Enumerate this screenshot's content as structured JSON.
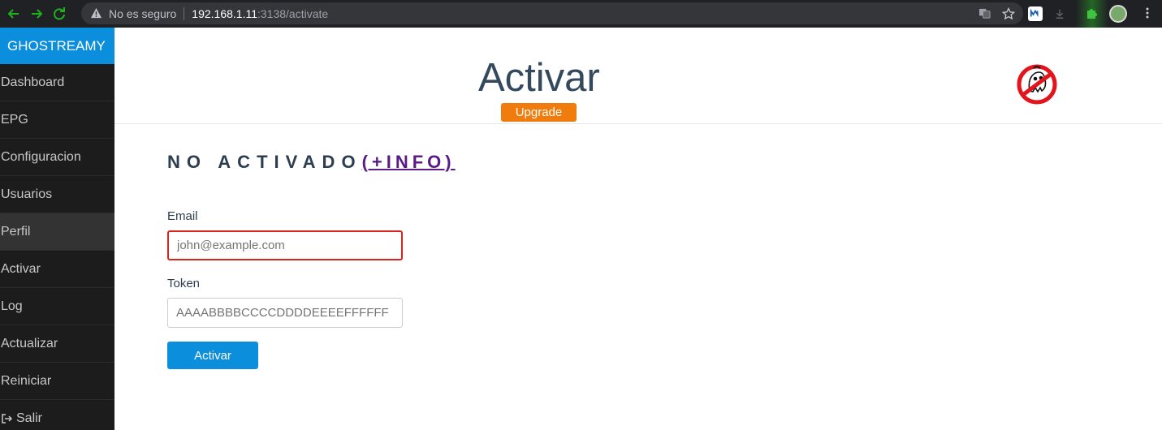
{
  "browser": {
    "security_label": "No es seguro",
    "url_host": "192.168.1.11",
    "url_rest": ":3138/activate"
  },
  "sidebar": {
    "brand": "GHOSTREAMY",
    "items": [
      {
        "label": "Dashboard"
      },
      {
        "label": "EPG"
      },
      {
        "label": "Configuracion"
      },
      {
        "label": "Usuarios"
      },
      {
        "label": "Perfil",
        "active": true
      },
      {
        "label": "Activar"
      },
      {
        "label": "Log"
      },
      {
        "label": "Actualizar"
      },
      {
        "label": "Reiniciar"
      },
      {
        "label": "Salir",
        "icon": "exit-icon"
      }
    ]
  },
  "header": {
    "title": "Activar",
    "upgrade_label": "Upgrade",
    "logo_icon": "ghost-logo-icon"
  },
  "status": {
    "text": "NO ACTIVADO",
    "link": "(+INFO)"
  },
  "form": {
    "email_label": "Email",
    "email_placeholder": "john@example.com",
    "email_value": "",
    "token_label": "Token",
    "token_placeholder": "AAAABBBBCCCCDDDDEEEEFFFFFF",
    "submit_label": "Activar"
  },
  "colors": {
    "brand": "#0b8edb",
    "upgrade": "#f07c0d",
    "error_border": "#d9241c",
    "link": "#5b1a8a"
  }
}
